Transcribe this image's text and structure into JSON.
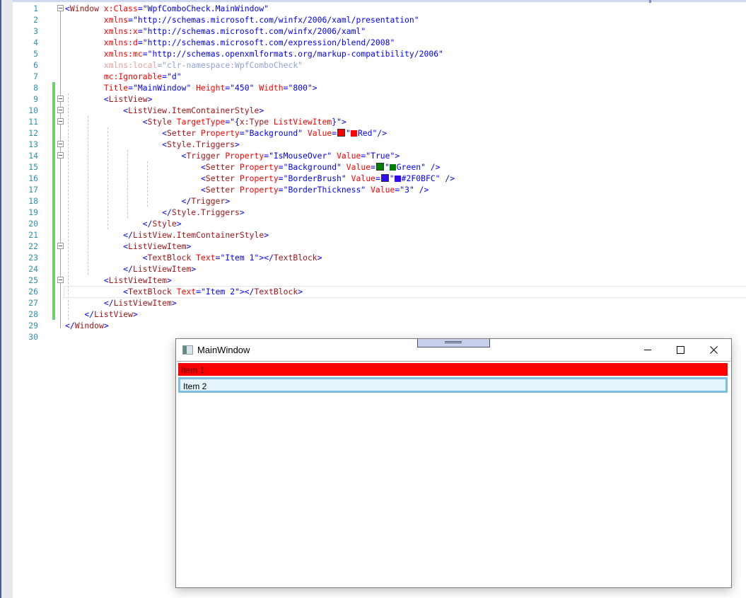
{
  "editor": {
    "lines": [
      {
        "n": "1",
        "html": [
          [
            "b",
            "<"
          ],
          [
            "t",
            "Window"
          ],
          [
            "a",
            " x:Class"
          ],
          [
            "b",
            "="
          ],
          [
            "v",
            "\"WpfComboCheck.MainWindow\""
          ]
        ]
      },
      {
        "n": "2",
        "html": [
          [
            "a",
            "        xmlns"
          ],
          [
            "b",
            "="
          ],
          [
            "v",
            "\"http://schemas.microsoft.com/winfx/2006/xaml/presentation\""
          ]
        ]
      },
      {
        "n": "3",
        "html": [
          [
            "a",
            "        xmlns:x"
          ],
          [
            "b",
            "="
          ],
          [
            "v",
            "\"http://schemas.microsoft.com/winfx/2006/xaml\""
          ]
        ]
      },
      {
        "n": "4",
        "html": [
          [
            "a",
            "        xmlns:d"
          ],
          [
            "b",
            "="
          ],
          [
            "v",
            "\"http://schemas.microsoft.com/expression/blend/2008\""
          ]
        ]
      },
      {
        "n": "5",
        "html": [
          [
            "a",
            "        xmlns:mc"
          ],
          [
            "b",
            "="
          ],
          [
            "v",
            "\"http://schemas.openxmlformats.org/markup-compatibility/2006\""
          ]
        ]
      },
      {
        "n": "6",
        "html": [
          [
            "gr",
            "        xmlns:local"
          ],
          [
            "g",
            "=\"clr-namespace:WpfComboCheck\""
          ]
        ]
      },
      {
        "n": "7",
        "html": [
          [
            "a",
            "        mc:Ignorable"
          ],
          [
            "b",
            "="
          ],
          [
            "v",
            "\"d\""
          ]
        ]
      },
      {
        "n": "8",
        "html": [
          [
            "a",
            "        Title"
          ],
          [
            "b",
            "="
          ],
          [
            "v",
            "\"MainWindow\""
          ],
          [
            "a",
            " Height"
          ],
          [
            "b",
            "="
          ],
          [
            "v",
            "\"450\""
          ],
          [
            "a",
            " Width"
          ],
          [
            "b",
            "="
          ],
          [
            "v",
            "\"800\""
          ],
          [
            "b",
            ">"
          ]
        ]
      },
      {
        "n": "9",
        "html": [
          [
            "b",
            "        <"
          ],
          [
            "t",
            "ListView"
          ],
          [
            "b",
            ">"
          ]
        ]
      },
      {
        "n": "10",
        "html": [
          [
            "b",
            "            <"
          ],
          [
            "t",
            "ListView.ItemContainerStyle"
          ],
          [
            "b",
            ">"
          ]
        ]
      },
      {
        "n": "11",
        "html": [
          [
            "b",
            "                <"
          ],
          [
            "t",
            "Style"
          ],
          [
            "a",
            " TargetType"
          ],
          [
            "b",
            "="
          ],
          [
            "v",
            "\"{"
          ],
          [
            "t",
            "x:Type"
          ],
          [
            "a",
            " ListViewItem"
          ],
          [
            "v",
            "}\""
          ],
          [
            "b",
            ">"
          ]
        ]
      },
      {
        "n": "12",
        "html": [
          [
            "b",
            "                    <"
          ],
          [
            "t",
            "Setter"
          ],
          [
            "a",
            " Property"
          ],
          [
            "b",
            "="
          ],
          [
            "v",
            "\"Background\""
          ],
          [
            "a",
            " Value"
          ],
          [
            "b",
            "="
          ],
          [
            "sw",
            "#ff0000"
          ],
          [
            "v",
            "\""
          ],
          [
            "sw2",
            "#ff0000"
          ],
          [
            "v",
            "Red\""
          ],
          [
            "b",
            "/>"
          ]
        ]
      },
      {
        "n": "13",
        "html": [
          [
            "b",
            "                    <"
          ],
          [
            "t",
            "Style.Triggers"
          ],
          [
            "b",
            ">"
          ]
        ]
      },
      {
        "n": "14",
        "html": [
          [
            "b",
            "                        <"
          ],
          [
            "t",
            "Trigger"
          ],
          [
            "a",
            " Property"
          ],
          [
            "b",
            "="
          ],
          [
            "v",
            "\"IsMouseOver\""
          ],
          [
            "a",
            " Value"
          ],
          [
            "b",
            "="
          ],
          [
            "v",
            "\"True\""
          ],
          [
            "b",
            ">"
          ]
        ]
      },
      {
        "n": "15",
        "html": [
          [
            "b",
            "                            <"
          ],
          [
            "t",
            "Setter"
          ],
          [
            "a",
            " Property"
          ],
          [
            "b",
            "="
          ],
          [
            "v",
            "\"Background\""
          ],
          [
            "a",
            " Value"
          ],
          [
            "b",
            "="
          ],
          [
            "sw",
            "#008000"
          ],
          [
            "v",
            "\""
          ],
          [
            "sw2",
            "#008000"
          ],
          [
            "v",
            "Green\""
          ],
          [
            "b",
            " />"
          ]
        ]
      },
      {
        "n": "16",
        "html": [
          [
            "b",
            "                            <"
          ],
          [
            "t",
            "Setter"
          ],
          [
            "a",
            " Property"
          ],
          [
            "b",
            "="
          ],
          [
            "v",
            "\"BorderBrush\""
          ],
          [
            "a",
            " Value"
          ],
          [
            "b",
            "="
          ],
          [
            "sw",
            "#2f0bfc"
          ],
          [
            "v",
            "\""
          ],
          [
            "sw2",
            "#2f0bfc"
          ],
          [
            "v",
            "#2F0BFC\""
          ],
          [
            "b",
            " />"
          ]
        ]
      },
      {
        "n": "17",
        "html": [
          [
            "b",
            "                            <"
          ],
          [
            "t",
            "Setter"
          ],
          [
            "a",
            " Property"
          ],
          [
            "b",
            "="
          ],
          [
            "v",
            "\"BorderThickness\""
          ],
          [
            "a",
            " Value"
          ],
          [
            "b",
            "="
          ],
          [
            "v",
            "\"3\""
          ],
          [
            "b",
            " />"
          ]
        ]
      },
      {
        "n": "18",
        "html": [
          [
            "b",
            "                        </"
          ],
          [
            "t",
            "Trigger"
          ],
          [
            "b",
            ">"
          ]
        ]
      },
      {
        "n": "19",
        "html": [
          [
            "b",
            "                    </"
          ],
          [
            "t",
            "Style.Triggers"
          ],
          [
            "b",
            ">"
          ]
        ]
      },
      {
        "n": "20",
        "html": [
          [
            "b",
            "                </"
          ],
          [
            "t",
            "Style"
          ],
          [
            "b",
            ">"
          ]
        ]
      },
      {
        "n": "21",
        "html": [
          [
            "b",
            "            </"
          ],
          [
            "t",
            "ListView.ItemContainerStyle"
          ],
          [
            "b",
            ">"
          ]
        ]
      },
      {
        "n": "22",
        "html": [
          [
            "b",
            "            <"
          ],
          [
            "t",
            "ListViewItem"
          ],
          [
            "b",
            ">"
          ]
        ]
      },
      {
        "n": "23",
        "html": [
          [
            "b",
            "                <"
          ],
          [
            "t",
            "TextBlock"
          ],
          [
            "a",
            " Text"
          ],
          [
            "b",
            "="
          ],
          [
            "v",
            "\"Item 1\""
          ],
          [
            "b",
            "></"
          ],
          [
            "t",
            "TextBlock"
          ],
          [
            "b",
            ">"
          ]
        ]
      },
      {
        "n": "24",
        "html": [
          [
            "b",
            "            </"
          ],
          [
            "t",
            "ListViewItem"
          ],
          [
            "b",
            ">"
          ]
        ]
      },
      {
        "n": "25",
        "html": [
          [
            "b",
            "        <"
          ],
          [
            "t",
            "ListViewItem"
          ],
          [
            "b",
            ">"
          ]
        ]
      },
      {
        "n": "26",
        "html": [
          [
            "b",
            "            <"
          ],
          [
            "t",
            "TextBlock"
          ],
          [
            "a",
            " Text"
          ],
          [
            "b",
            "="
          ],
          [
            "v",
            "\"Item 2\""
          ],
          [
            "b",
            "></"
          ],
          [
            "t",
            "TextBlock"
          ],
          [
            "b",
            ">"
          ]
        ]
      },
      {
        "n": "27",
        "html": [
          [
            "b",
            "        </"
          ],
          [
            "t",
            "ListViewItem"
          ],
          [
            "b",
            ">"
          ]
        ]
      },
      {
        "n": "28",
        "html": [
          [
            "b",
            "    </"
          ],
          [
            "t",
            "ListView"
          ],
          [
            "b",
            ">"
          ]
        ]
      },
      {
        "n": "29",
        "html": [
          [
            "b",
            "</"
          ],
          [
            "t",
            "Window"
          ],
          [
            "b",
            ">"
          ]
        ]
      },
      {
        "n": "30",
        "html": []
      }
    ],
    "fold_lines": [
      "1",
      "9",
      "10",
      "11",
      "13",
      "14",
      "22",
      "25"
    ],
    "changed_range": [
      "8",
      "28"
    ],
    "current_line": "26"
  },
  "window": {
    "title": "MainWindow",
    "minimize_label": "Minimize",
    "maximize_label": "Maximize",
    "close_label": "Close",
    "items": [
      {
        "text": "Item 1",
        "background": "#ff0000"
      },
      {
        "text": "Item 2",
        "background": "#e5f3fb",
        "border": "#7ebfe0"
      }
    ]
  }
}
